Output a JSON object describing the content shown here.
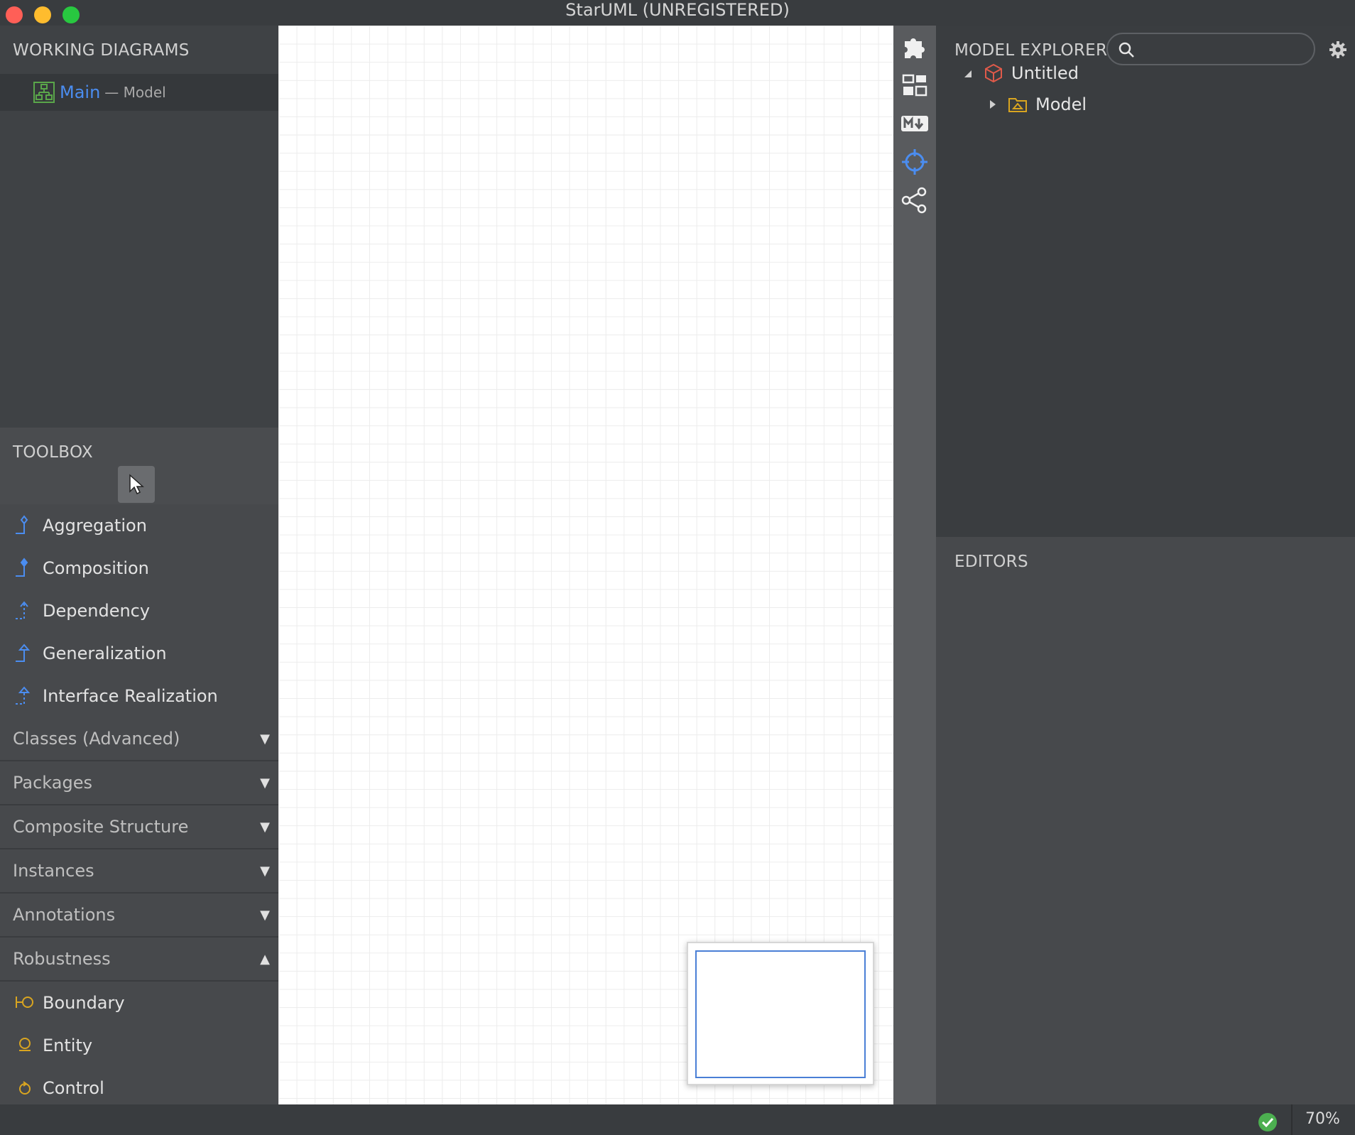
{
  "window": {
    "title": "StarUML (UNREGISTERED)"
  },
  "working_diagrams": {
    "title": "WORKING DIAGRAMS",
    "items": [
      {
        "name": "Main",
        "owner": "— Model",
        "icon": "class-diagram-icon"
      }
    ]
  },
  "toolbox": {
    "title": "TOOLBOX",
    "pointer_icon": "pointer-icon",
    "tools": [
      {
        "label": "Aggregation",
        "icon": "aggregation-icon"
      },
      {
        "label": "Composition",
        "icon": "composition-icon"
      },
      {
        "label": "Dependency",
        "icon": "dependency-icon"
      },
      {
        "label": "Generalization",
        "icon": "generalization-icon"
      },
      {
        "label": "Interface Realization",
        "icon": "interface-realization-icon"
      }
    ],
    "groups": [
      {
        "label": "Classes (Advanced)",
        "expanded": false
      },
      {
        "label": "Packages",
        "expanded": false
      },
      {
        "label": "Composite Structure",
        "expanded": false
      },
      {
        "label": "Instances",
        "expanded": false
      },
      {
        "label": "Annotations",
        "expanded": false
      },
      {
        "label": "Robustness",
        "expanded": true
      }
    ],
    "robustness_tools": [
      {
        "label": "Boundary",
        "icon": "boundary-icon"
      },
      {
        "label": "Entity",
        "icon": "entity-icon"
      },
      {
        "label": "Control",
        "icon": "control-icon"
      }
    ]
  },
  "iconbar": [
    "extensions-icon",
    "layout-icon",
    "markdown-icon",
    "crosshair-icon",
    "share-icon"
  ],
  "model_explorer": {
    "title": "MODEL EXPLORER",
    "search": {
      "value": "",
      "placeholder": ""
    },
    "tree": [
      {
        "label": "Untitled",
        "expanded": true,
        "icon": "project-icon"
      },
      {
        "label": "Model",
        "expanded": false,
        "icon": "model-icon"
      }
    ]
  },
  "editors": {
    "title": "EDITORS"
  },
  "status": {
    "zoom": "70%",
    "ok_icon": "check-circle-icon"
  },
  "colors": {
    "accent": "#4b8df0",
    "sidebar": "#47494c",
    "canvas": "#ffffff"
  }
}
